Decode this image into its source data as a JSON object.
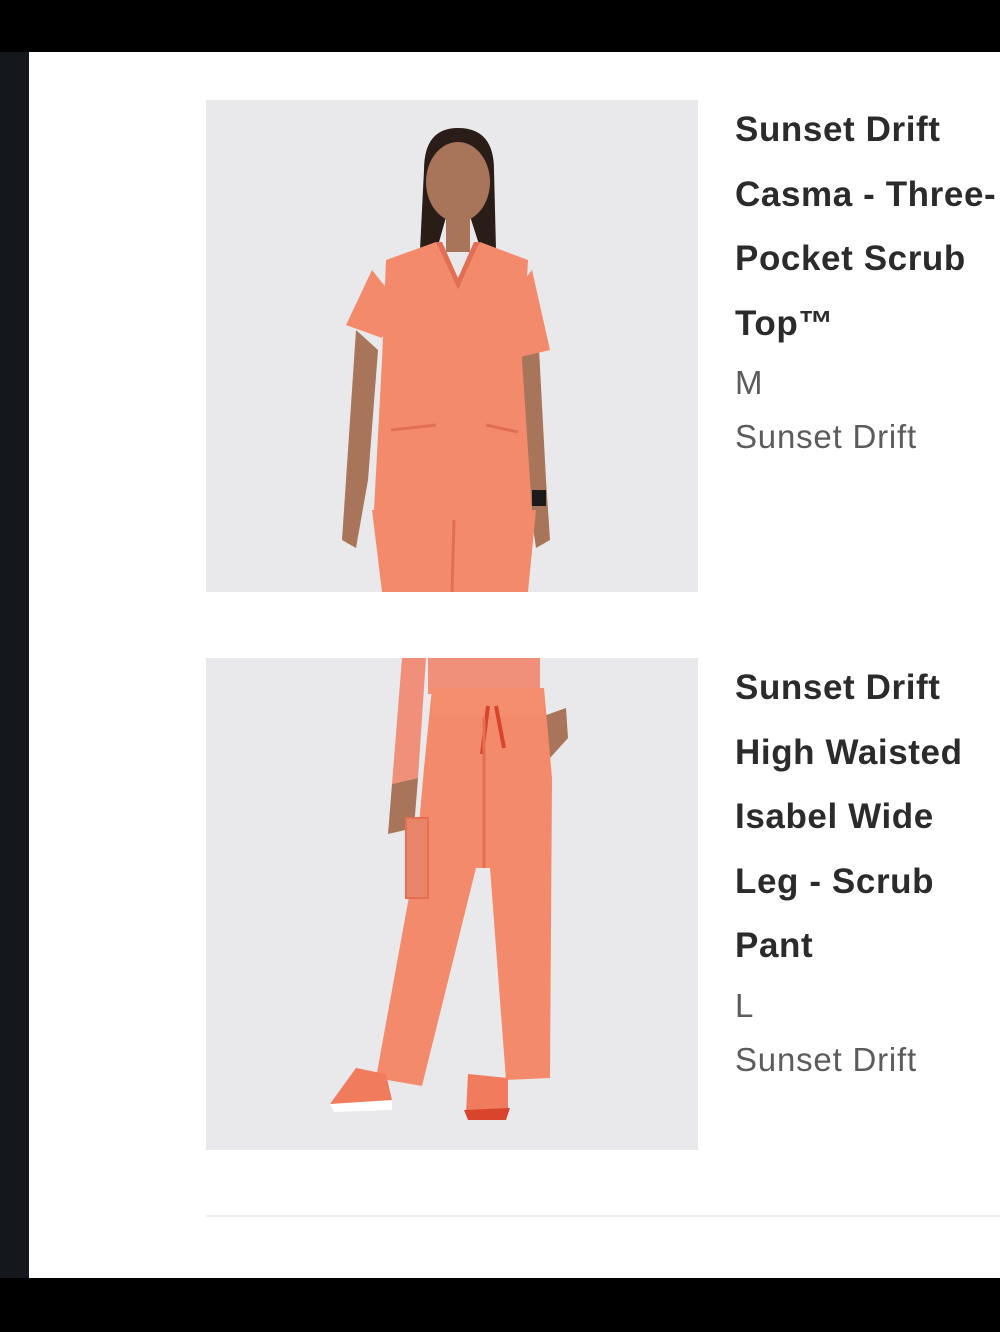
{
  "products": [
    {
      "title": "Sunset Drift Casma - Three-Pocket Scrub Top™",
      "size": "M",
      "color": "Sunset Drift",
      "image_icon": "product-photo-scrub-top"
    },
    {
      "title": "Sunset Drift High Waisted Isabel Wide Leg - Scrub Pant",
      "size": "L",
      "color": "Sunset Drift",
      "image_icon": "product-photo-scrub-pant"
    }
  ],
  "colors": {
    "scrub": "#f48a6c",
    "scrub_shadow": "#e26f53",
    "skin": "#a8745a",
    "hair": "#2a1c17",
    "photo_bg": "#e9e9eb"
  }
}
